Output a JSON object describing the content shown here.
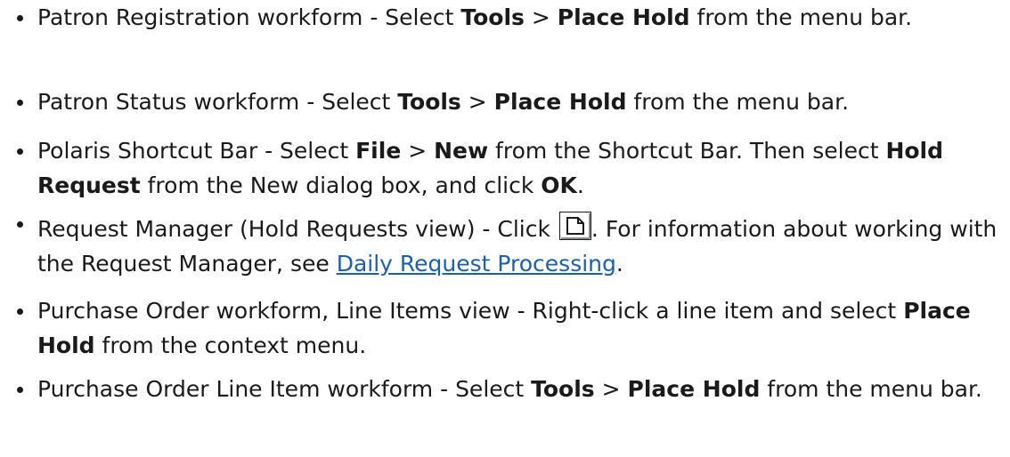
{
  "items": [
    {
      "t1": "Patron Registration workform - Select ",
      "b1": "Tools",
      "t2": " > ",
      "b2": "Place Hold",
      "t3": " from the menu bar."
    },
    {
      "t1": "Patron Status workform - Select ",
      "b1": "Tools",
      "t2": " > ",
      "b2": "Place Hold",
      "t3": " from the menu bar."
    },
    {
      "t1": "Polaris Shortcut Bar - Select ",
      "b1": "File",
      "t2": " > ",
      "b2": "New",
      "t3": " from the Shortcut Bar. Then select ",
      "b3": "Hold Request",
      "t4": " from the New dialog box, and click ",
      "b4": "OK",
      "t5": "."
    },
    {
      "t1": "Request Manager (Hold Requests view) - Click ",
      "icon": "new-document-icon",
      "t2": ". For information about working with the Request Manager, see ",
      "link": "Daily Request Processing",
      "t3": "."
    },
    {
      "t1": "Purchase Order workform, Line Items view - Right-click a line item and select ",
      "b1": "Place Hold",
      "t2": " from the context menu."
    },
    {
      "t1": "Purchase Order Line Item workform - Select ",
      "b1": "Tools",
      "t2": " > ",
      "b2": "Place Hold",
      "t3": " from the menu bar."
    }
  ],
  "colors": {
    "text": "#1a1a1a",
    "link": "#1a5fb4"
  }
}
